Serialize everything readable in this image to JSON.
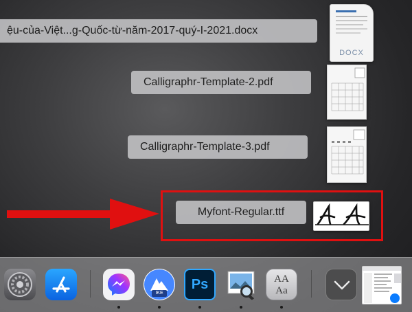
{
  "stack": {
    "items": [
      {
        "label": "ệu-của-Việt...g-Quốc-từ-năm-2017-quý-I-2021.docx",
        "badge": "DOCX"
      },
      {
        "label": "Calligraphr-Template-2.pdf"
      },
      {
        "label": "Calligraphr-Template-3.pdf"
      },
      {
        "label": "Myfont-Regular.ttf"
      }
    ]
  },
  "annotation": {
    "color": "#e01010"
  },
  "dock": {
    "apps": [
      {
        "name": "System Preferences",
        "icon": "gear-icon"
      },
      {
        "name": "App Store",
        "icon": "app-store-icon"
      },
      {
        "name": "Messenger",
        "icon": "messenger-icon"
      },
      {
        "name": "NordVPN",
        "icon": "nordvpn-icon",
        "badge": "IKE"
      },
      {
        "name": "Photoshop",
        "icon": "photoshop-icon",
        "glyph": "Ps"
      },
      {
        "name": "Preview",
        "icon": "preview-icon"
      },
      {
        "name": "Font Book",
        "icon": "font-book-icon",
        "glyph": "AA Aa"
      }
    ]
  }
}
